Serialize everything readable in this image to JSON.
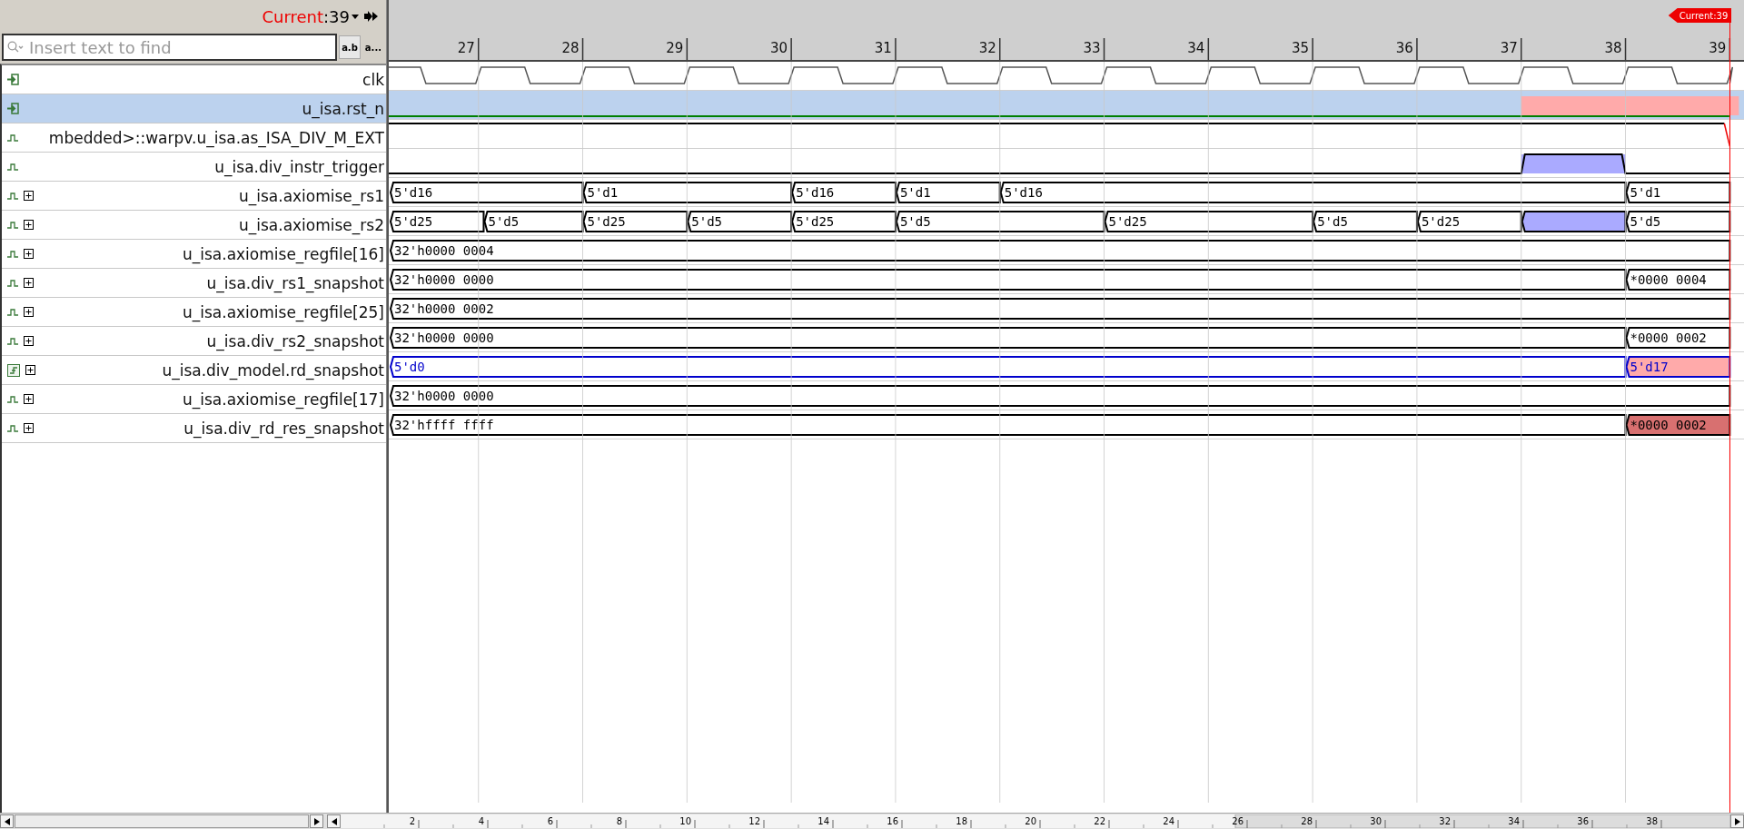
{
  "cursor": {
    "label": "Current",
    "value": ":39",
    "flag": "Current:39"
  },
  "search": {
    "placeholder": "Insert text to find",
    "options": [
      {
        "label": "a.b",
        "selected": true
      },
      {
        "label": "a...",
        "selected": false
      }
    ]
  },
  "time_ticks": [
    "27",
    "28",
    "29",
    "30",
    "31",
    "32",
    "33",
    "34",
    "35",
    "36",
    "37",
    "38",
    "39"
  ],
  "signals": [
    {
      "name": "clk",
      "kind": "input",
      "expandable": false,
      "selected": false,
      "wave": {
        "kind": "clock"
      }
    },
    {
      "name": "u_isa.rst_n",
      "kind": "input",
      "expandable": false,
      "selected": true,
      "wave": {
        "kind": "low",
        "color": "#008000",
        "marks": [
          {
            "color": "#ffaaaa"
          }
        ]
      }
    },
    {
      "name": "mbedded>::warpv.u_isa.as_ISA_DIV_M_EXT",
      "kind": "wire",
      "expandable": false,
      "selected": false,
      "wave": {
        "kind": "high_fail"
      }
    },
    {
      "name": "u_isa.div_instr_trigger",
      "kind": "wire",
      "expandable": false,
      "selected": false,
      "wave": {
        "kind": "pulse",
        "color": "#aaaaff"
      }
    },
    {
      "name": "u_isa.axiomise_rs1",
      "kind": "wire",
      "expandable": true,
      "selected": false,
      "wave": {
        "kind": "bus",
        "segments": [
          {
            "value": "5'd16"
          },
          {
            "value": "5'd1"
          },
          {
            "value": "5'd16"
          },
          {
            "value": "5'd1"
          },
          {
            "value": "5'd16"
          },
          {
            "value": "5'd1"
          }
        ]
      }
    },
    {
      "name": "u_isa.axiomise_rs2",
      "kind": "wire",
      "expandable": true,
      "selected": false,
      "wave": {
        "kind": "bus",
        "segments": [
          {
            "value": "5'd25"
          },
          {
            "value": "5'd5"
          },
          {
            "value": "5'd25"
          },
          {
            "value": "5'd5"
          },
          {
            "value": "5'd25"
          },
          {
            "value": "5'd5"
          },
          {
            "value": "5'd25"
          },
          {
            "value": "5'd5"
          },
          {
            "value": "5'd25"
          },
          {
            "color": "#aaaaff"
          },
          {
            "value": "5'd5"
          }
        ]
      }
    },
    {
      "name": "u_isa.axiomise_regfile[16]",
      "kind": "wire",
      "expandable": true,
      "selected": false,
      "wave": {
        "kind": "bus",
        "segments": [
          {
            "value": "32'h0000 0004"
          }
        ]
      }
    },
    {
      "name": "u_isa.div_rs1_snapshot",
      "kind": "wire",
      "expandable": true,
      "selected": false,
      "wave": {
        "kind": "bus",
        "segments": [
          {
            "value": "32'h0000 0000"
          },
          {
            "value": "*0000 0004"
          }
        ]
      }
    },
    {
      "name": "u_isa.axiomise_regfile[25]",
      "kind": "wire",
      "expandable": true,
      "selected": false,
      "wave": {
        "kind": "bus",
        "segments": [
          {
            "value": "32'h0000 0002"
          }
        ]
      }
    },
    {
      "name": "u_isa.div_rs2_snapshot",
      "kind": "wire",
      "expandable": true,
      "selected": false,
      "wave": {
        "kind": "bus",
        "segments": [
          {
            "value": "32'h0000 0000"
          },
          {
            "value": "*0000 0002"
          }
        ]
      }
    },
    {
      "name": "u_isa.div_model.rd_snapshot",
      "kind": "probe",
      "expandable": true,
      "selected": false,
      "wave": {
        "kind": "bus",
        "color": "#0000cc",
        "segments": [
          {
            "value": "5'd0"
          },
          {
            "value": "5'd17",
            "color": "#ffaaaa"
          }
        ]
      }
    },
    {
      "name": "u_isa.axiomise_regfile[17]",
      "kind": "wire",
      "expandable": true,
      "selected": false,
      "wave": {
        "kind": "bus",
        "segments": [
          {
            "value": "32'h0000 0000"
          }
        ]
      }
    },
    {
      "name": "u_isa.div_rd_res_snapshot",
      "kind": "wire",
      "expandable": true,
      "selected": false,
      "wave": {
        "kind": "bus",
        "segments": [
          {
            "value": "32'hffff ffff"
          },
          {
            "value": "*0000 0002",
            "color": "#d87070"
          }
        ]
      }
    }
  ],
  "overview_ticks": [
    "2",
    "4",
    "6",
    "8",
    "10",
    "12",
    "14",
    "16",
    "18",
    "20",
    "22",
    "24",
    "26",
    "28",
    "30",
    "32",
    "34",
    "36",
    "38"
  ]
}
